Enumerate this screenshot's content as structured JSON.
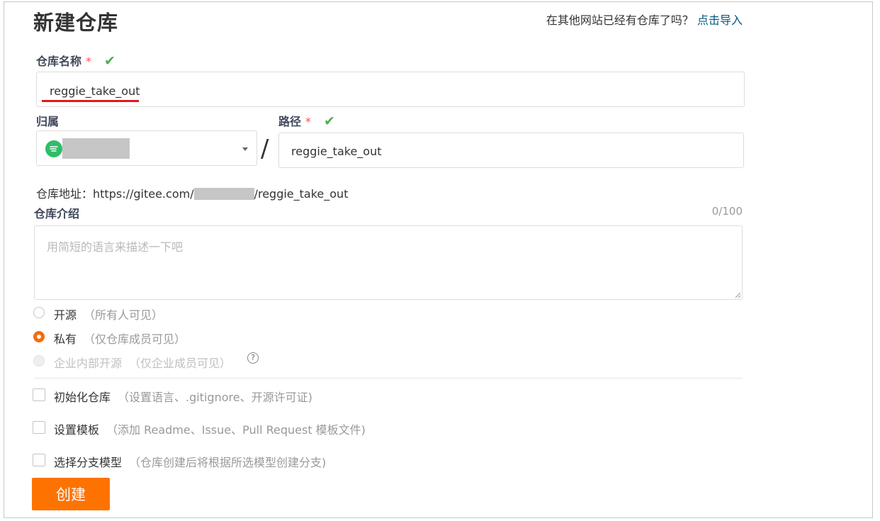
{
  "page": {
    "title": "新建仓库"
  },
  "import": {
    "prompt": "在其他网站已经有仓库了吗？",
    "link": "点击导入"
  },
  "repo_name": {
    "label": "仓库名称",
    "required_mark": "*",
    "value": "reggie_take_out"
  },
  "owner": {
    "label": "归属",
    "separator": "/"
  },
  "path": {
    "label": "路径",
    "required_mark": "*",
    "value": "reggie_take_out"
  },
  "address": {
    "label": "仓库地址：",
    "prefix": "https://gitee.com/",
    "suffix": "/reggie_take_out"
  },
  "description": {
    "label": "仓库介绍",
    "counter": "0/100",
    "placeholder": "用简短的语言来描述一下吧"
  },
  "visibility": {
    "options": [
      {
        "label": "开源",
        "hint": "（所有人可见）",
        "selected": false,
        "disabled": false
      },
      {
        "label": "私有",
        "hint": "（仅仓库成员可见）",
        "selected": true,
        "disabled": false
      },
      {
        "label": "企业内部开源",
        "hint": "（仅企业成员可见）",
        "selected": false,
        "disabled": true
      }
    ],
    "help_glyph": "?"
  },
  "init_options": [
    {
      "label": "初始化仓库",
      "hint": "（设置语言、.gitignore、开源许可证)"
    },
    {
      "label": "设置模板",
      "hint": "（添加 Readme、Issue、Pull Request 模板文件)"
    },
    {
      "label": "选择分支模型",
      "hint": "（仓库创建后将根据所选模型创建分支)"
    }
  ],
  "submit": {
    "label": "创建"
  },
  "colors": {
    "accent": "#fe7300",
    "link": "#005980",
    "check": "#4caf50",
    "required": "#ff4d4f"
  }
}
